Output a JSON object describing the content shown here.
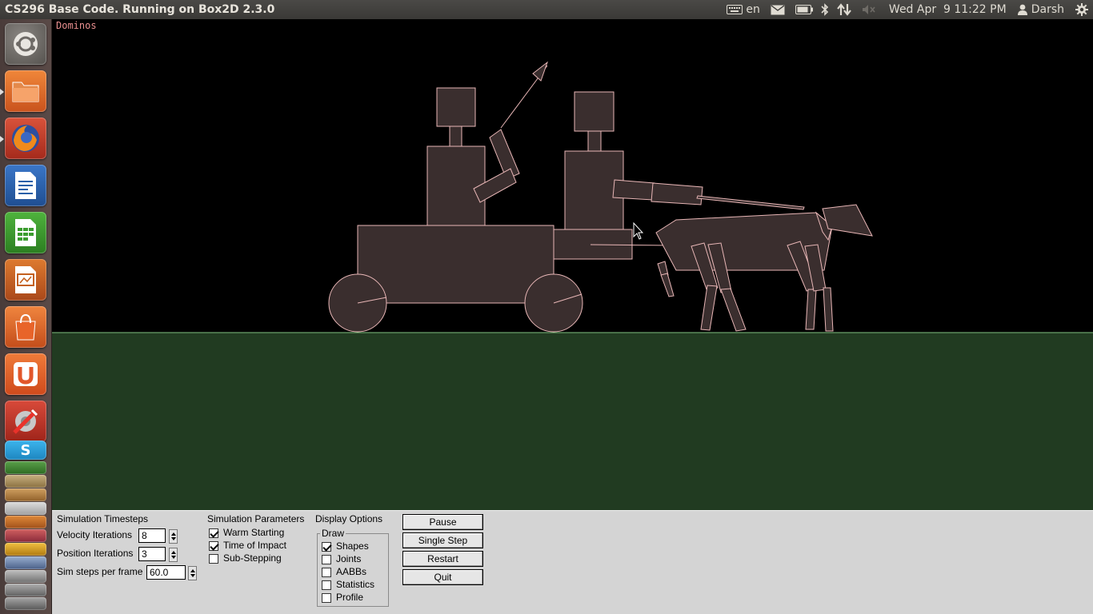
{
  "topbar": {
    "title": "CS296 Base Code. Running on Box2D 2.3.0",
    "keyboard_layout": "en",
    "clock": "Wed Apr  9 11:22 PM",
    "user": "Darsh",
    "indicator_icons": [
      "keyboard-icon",
      "mail-icon",
      "battery-icon",
      "bluetooth-icon",
      "network-icon",
      "volume-muted-icon",
      "gear-icon"
    ]
  },
  "launcher": {
    "items": [
      {
        "name": "ubuntu-dash",
        "icon": "ubuntu-logo-icon",
        "color": "#6e6a66"
      },
      {
        "name": "files",
        "icon": "folder-icon",
        "color": "#e06a2a"
      },
      {
        "name": "firefox",
        "icon": "firefox-icon",
        "color": "#c0392b"
      },
      {
        "name": "libreoffice-writer",
        "icon": "writer-document-icon",
        "color": "#2a5fa8"
      },
      {
        "name": "libreoffice-calc",
        "icon": "calc-spreadsheet-icon",
        "color": "#3b9c2e"
      },
      {
        "name": "libreoffice-impress",
        "icon": "impress-presentation-icon",
        "color": "#c4601e"
      },
      {
        "name": "software-center",
        "icon": "shopping-bag-icon",
        "color": "#e0692a"
      },
      {
        "name": "ubuntu-one",
        "icon": "ubuntu-one-icon",
        "color": "#e2562a"
      },
      {
        "name": "system-settings",
        "icon": "settings-tools-icon",
        "color": "#c0392b"
      },
      {
        "name": "skype",
        "icon": "skype-icon",
        "color": "#2aa0dc"
      }
    ]
  },
  "sim": {
    "label": "Dominos",
    "sky_color": "#000000",
    "ground_color": "#213b21",
    "shape_fill": "#3a2e2e",
    "shape_stroke": "#e8b6b6"
  },
  "panel": {
    "timesteps": {
      "heading": "Simulation Timesteps",
      "velocity_label": "Velocity Iterations",
      "velocity_value": "8",
      "position_label": "Position Iterations",
      "position_value": "3",
      "steps_label": "Sim steps per frame",
      "steps_value": "60.0"
    },
    "parameters": {
      "heading": "Simulation Parameters",
      "options": [
        {
          "label": "Warm Starting",
          "checked": true
        },
        {
          "label": "Time of Impact",
          "checked": true
        },
        {
          "label": "Sub-Stepping",
          "checked": false
        }
      ]
    },
    "display": {
      "heading": "Display Options",
      "group_label": "Draw",
      "options": [
        {
          "label": "Shapes",
          "checked": true
        },
        {
          "label": "Joints",
          "checked": false
        },
        {
          "label": "AABBs",
          "checked": false
        },
        {
          "label": "Statistics",
          "checked": false
        },
        {
          "label": "Profile",
          "checked": false
        }
      ]
    },
    "buttons": {
      "pause": "Pause",
      "single_step": "Single Step",
      "restart": "Restart",
      "quit": "Quit"
    }
  }
}
